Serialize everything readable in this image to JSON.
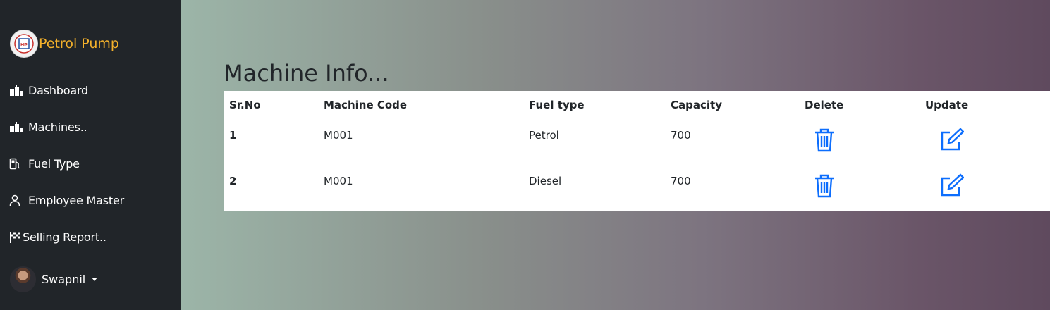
{
  "sidebar": {
    "brand": {
      "name": "Petrol Pump",
      "logo_icon": "hp-logo-icon"
    },
    "items": [
      {
        "label": "Dashboard",
        "icon": "building-icon"
      },
      {
        "label": "Machines..",
        "icon": "building-icon"
      },
      {
        "label": "Fuel Type",
        "icon": "fuel-pump-icon"
      },
      {
        "label": "Employee Master",
        "icon": "person-icon"
      },
      {
        "label": "Selling Report..",
        "icon": "flag-checkered-icon"
      }
    ],
    "user": {
      "name": "Swapnil",
      "icon": "caret-down-icon"
    }
  },
  "main": {
    "title": "Machine Info...",
    "table": {
      "headers": [
        "Sr.No",
        "Machine Code",
        "Fuel type",
        "Capacity",
        "Delete",
        "Update"
      ],
      "rows": [
        {
          "sr": "1",
          "code": "M001",
          "fuel": "Petrol",
          "capacity": "700"
        },
        {
          "sr": "2",
          "code": "M001",
          "fuel": "Diesel",
          "capacity": "700"
        }
      ],
      "delete_icon": "trash-icon",
      "update_icon": "pencil-square-icon"
    }
  },
  "colors": {
    "sidebar_bg": "#212529",
    "brand_text": "#f4b12b",
    "action_icon": "#0d6efd"
  }
}
